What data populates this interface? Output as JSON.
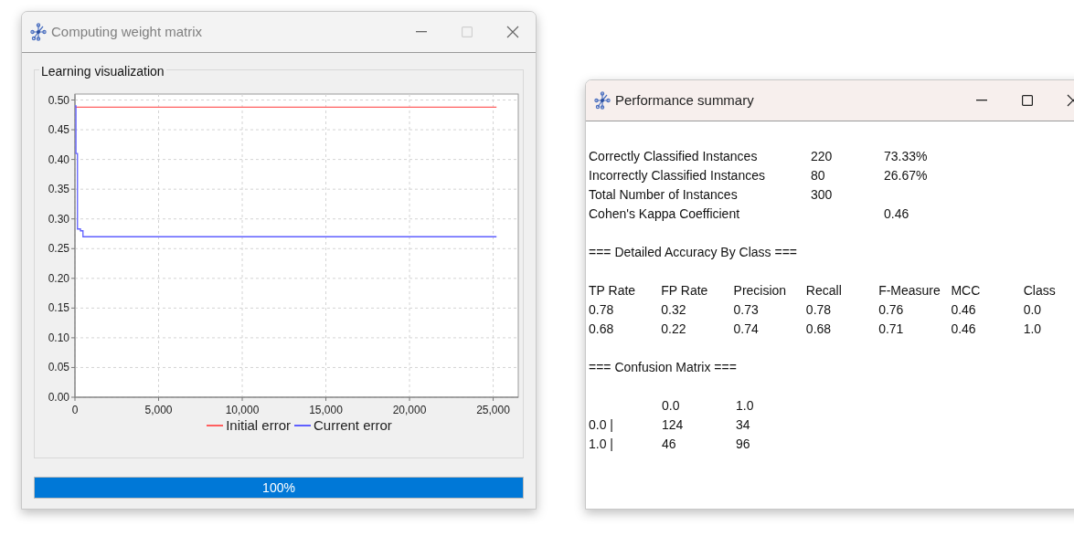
{
  "training_window": {
    "title": "Computing weight matrix",
    "maximize_disabled": true,
    "group_title": "Learning visualization",
    "chart_data": {
      "type": "line",
      "x": [
        0,
        60,
        150,
        330,
        480,
        25200
      ],
      "series": [
        {
          "name": "Initial error",
          "color": "#ff5f5f",
          "values": [
            0.488,
            0.488,
            0.488,
            0.488,
            0.488,
            0.488
          ]
        },
        {
          "name": "Current error",
          "color": "#5f5fff",
          "values": [
            0.49,
            0.41,
            0.283,
            0.28,
            0.27,
            0.27
          ]
        }
      ],
      "grid": true,
      "legend": true,
      "xlim": [
        0,
        26500
      ],
      "ylim": [
        0,
        0.51
      ],
      "xticks": [
        {
          "value": 0,
          "label": "0"
        },
        {
          "value": 5000,
          "label": "5,000"
        },
        {
          "value": 10000,
          "label": "10,000"
        },
        {
          "value": 15000,
          "label": "15,000"
        },
        {
          "value": 20000,
          "label": "20,000"
        },
        {
          "value": 25000,
          "label": "25,000"
        }
      ],
      "yticks": [
        {
          "value": 0,
          "label": "0.00"
        },
        {
          "value": 0.05,
          "label": "0.05"
        },
        {
          "value": 0.1,
          "label": "0.10"
        },
        {
          "value": 0.15,
          "label": "0.15"
        },
        {
          "value": 0.2,
          "label": "0.20"
        },
        {
          "value": 0.25,
          "label": "0.25"
        },
        {
          "value": 0.3,
          "label": "0.30"
        },
        {
          "value": 0.35,
          "label": "0.35"
        },
        {
          "value": 0.4,
          "label": "0.40"
        },
        {
          "value": 0.45,
          "label": "0.45"
        },
        {
          "value": 0.5,
          "label": "0.50"
        }
      ]
    },
    "progress": {
      "level": 1,
      "reading": "100%"
    }
  },
  "summary_window": {
    "title": "Performance summary",
    "maximize_disabled": false,
    "summary_rows": [
      {
        "label": "Correctly Classified Instances",
        "count": "220",
        "percent": "73.33%"
      },
      {
        "label": "Incorrectly Classified Instances",
        "count": "80",
        "percent": "26.67%"
      },
      {
        "label": "Total Number of Instances",
        "count": "300"
      },
      {
        "label": "Cohen's Kappa Coefficient",
        "percent": "0.46"
      }
    ],
    "accuracy_heading": "=== Detailed Accuracy By Class ===",
    "accuracy_columns": [
      "TP Rate",
      "FP Rate",
      "Precision",
      "Recall",
      "F-Measure",
      "MCC",
      "Class"
    ],
    "accuracy_rows": [
      [
        "0.78",
        "0.32",
        "0.73",
        "0.78",
        "0.76",
        "0.46",
        "0.0"
      ],
      [
        "0.68",
        "0.22",
        "0.74",
        "0.68",
        "0.71",
        "0.46",
        "1.0"
      ]
    ],
    "confusion_heading": "=== Confusion Matrix ===",
    "confusion_header": [
      "0.0",
      "1.0"
    ],
    "confusion_rows": [
      {
        "label": "0.0 |",
        "cells": [
          "124",
          "34"
        ]
      },
      {
        "label": "1.0 |",
        "cells": [
          "46",
          "96"
        ]
      }
    ]
  }
}
